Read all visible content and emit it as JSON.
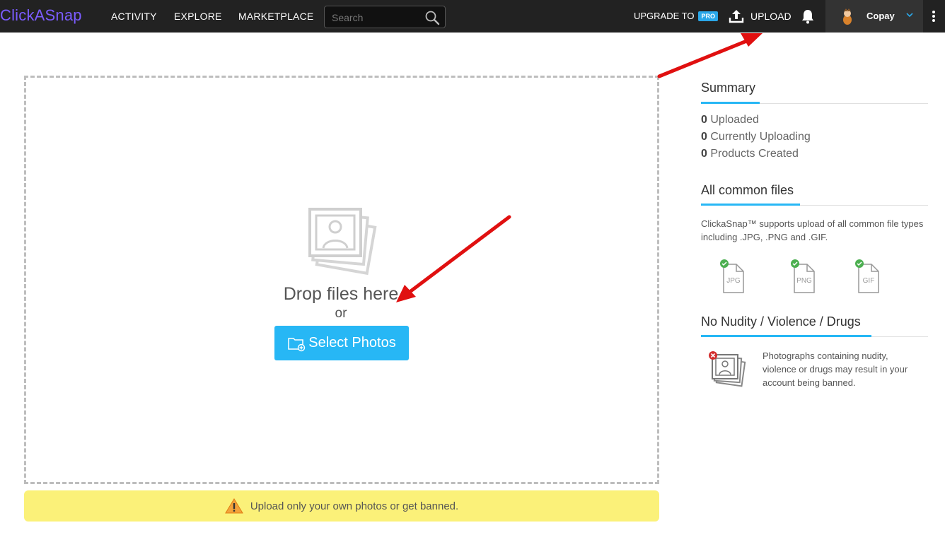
{
  "header": {
    "logo": "ClickASnap",
    "nav": [
      "ACTIVITY",
      "EXPLORE",
      "MARKETPLACE"
    ],
    "search_placeholder": "Search",
    "upgrade_label": "UPGRADE TO",
    "pro_badge": "PRO",
    "upload_label": "UPLOAD",
    "username": "Copay"
  },
  "upload": {
    "drop_text": "Drop files here",
    "or_text": "or",
    "select_button": "Select Photos",
    "warning": "Upload only your own photos or get banned."
  },
  "summary": {
    "title": "Summary",
    "items": [
      {
        "count": "0",
        "label": "Uploaded"
      },
      {
        "count": "0",
        "label": "Currently Uploading"
      },
      {
        "count": "0",
        "label": "Products Created"
      }
    ]
  },
  "common_files": {
    "title": "All common files",
    "description": "ClickaSnap™ supports upload of all common file types including .JPG, .PNG and .GIF.",
    "types": [
      "JPG",
      "PNG",
      "GIF"
    ]
  },
  "nudity": {
    "title": "No Nudity / Violence / Drugs",
    "description": "Photographs containing nudity, violence or drugs may result in your account being banned."
  },
  "colors": {
    "topbar": "#222222",
    "accent": "#27b7f5",
    "warning_bg": "#fbf179",
    "annotation_arrow": "#e01010"
  }
}
